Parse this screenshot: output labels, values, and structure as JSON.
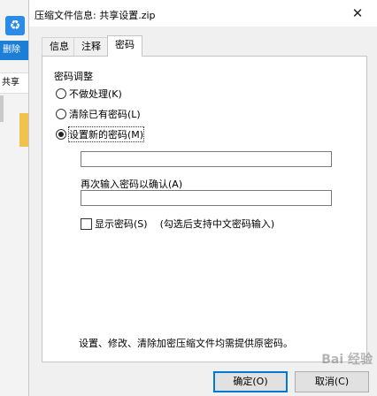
{
  "background": {
    "strip_button": "删除",
    "strip_tab": "共享",
    "app_icon": "recycle-icon"
  },
  "dialog": {
    "title": "压缩文件信息: 共享设置.zip",
    "close_glyph": "✕"
  },
  "tabs": [
    {
      "label": "信息"
    },
    {
      "label": "注释"
    },
    {
      "label": "密码"
    }
  ],
  "password_panel": {
    "group_label": "密码调整",
    "options": [
      {
        "label": "不做处理(K)",
        "checked": false
      },
      {
        "label": "清除已有密码(L)",
        "checked": false
      },
      {
        "label": "设置新的密码(M)",
        "checked": true
      }
    ],
    "password_value": "",
    "confirm_label": "再次输入密码以确认(A)",
    "confirm_value": "",
    "show_password_label": "显示密码(S)",
    "show_password_hint": "(勾选后支持中文密码输入)",
    "note": "设置、修改、清除加密压缩文件均需提供原密码。"
  },
  "buttons": {
    "ok": "确定(O)",
    "cancel": "取消(C)"
  },
  "watermark": "Bai 经验"
}
